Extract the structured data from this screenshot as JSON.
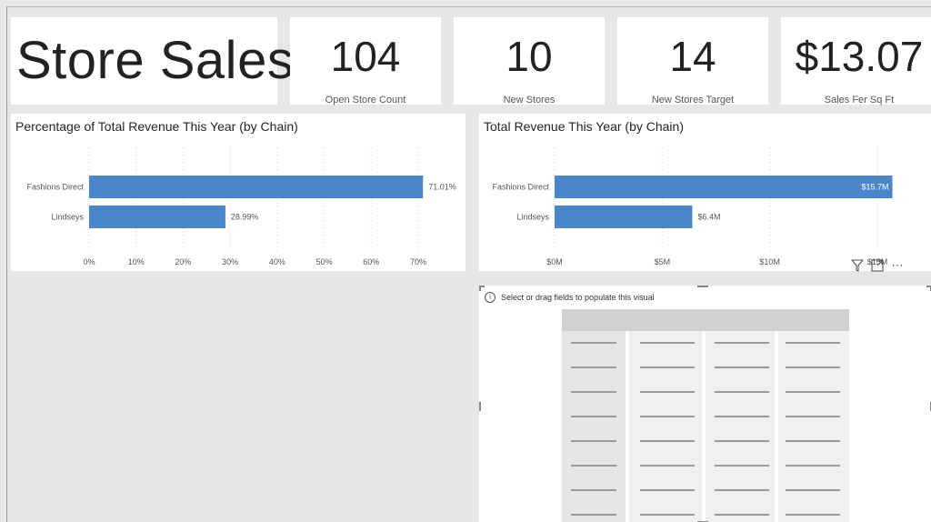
{
  "title": "Store Sales",
  "kpis": [
    {
      "value": "104",
      "label": "Open Store Count"
    },
    {
      "value": "10",
      "label": "New Stores"
    },
    {
      "value": "14",
      "label": "New Stores Target"
    },
    {
      "value": "$13.07",
      "label": "Sales Fer Sq Ft"
    }
  ],
  "visual_hint": "Select or drag fields to populate this visual",
  "toolbar": {
    "filter_icon": "filter-icon",
    "focus_icon": "focus-mode-icon",
    "more_icon": "more-options-icon"
  },
  "colors": {
    "bar": "#4a86c8",
    "grid": "#d9d9d9"
  },
  "chart_data": [
    {
      "type": "bar",
      "orientation": "horizontal",
      "title": "Percentage of Total Revenue This Year (by Chain)",
      "categories": [
        "Fashions Direct",
        "Lindseys"
      ],
      "values": [
        71.01,
        28.99
      ],
      "data_labels": [
        "71.01%",
        "28.99%"
      ],
      "xlim": [
        0,
        70
      ],
      "xticks": [
        "0%",
        "10%",
        "20%",
        "30%",
        "40%",
        "50%",
        "60%",
        "70%"
      ],
      "xtick_values": [
        0,
        10,
        20,
        30,
        40,
        50,
        60,
        70
      ],
      "grid": true
    },
    {
      "type": "bar",
      "orientation": "horizontal",
      "title": "Total Revenue This Year (by Chain)",
      "categories": [
        "Fashions Direct",
        "Lindseys"
      ],
      "values": [
        15.7,
        6.4
      ],
      "data_labels": [
        "$15.7M",
        "$6.4M"
      ],
      "xlim": [
        0,
        15
      ],
      "xticks": [
        "$0M",
        "$5M",
        "$10M",
        "$15M"
      ],
      "xtick_values": [
        0,
        5,
        10,
        15
      ],
      "grid": true
    }
  ]
}
